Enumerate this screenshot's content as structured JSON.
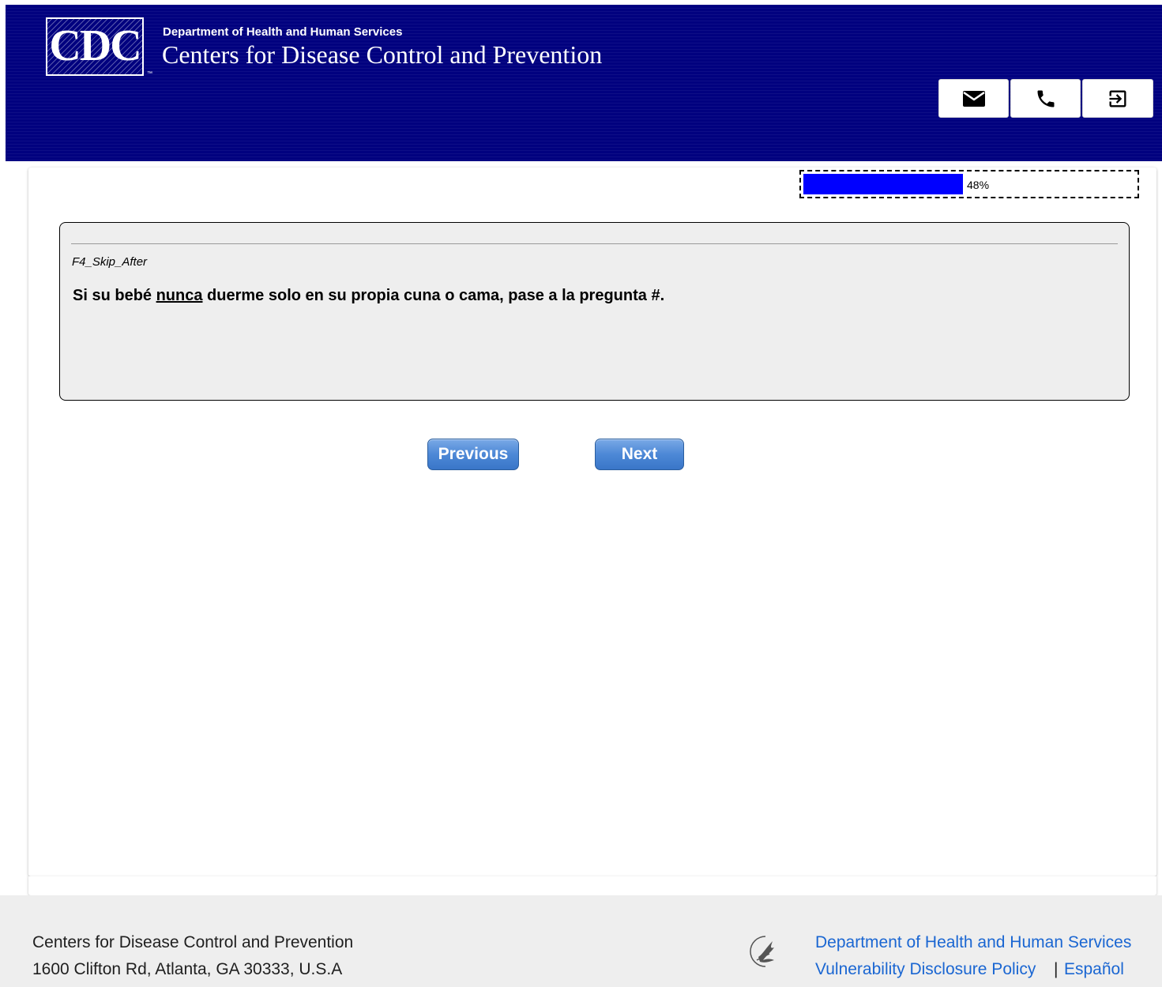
{
  "header": {
    "logo_text": "CDC",
    "department": "Department of Health and Human Services",
    "agency": "Centers for Disease Control and Prevention",
    "buttons": [
      {
        "icon": "mail-icon"
      },
      {
        "icon": "phone-icon"
      },
      {
        "icon": "exit-icon"
      }
    ],
    "background_color": "#01017f"
  },
  "progress": {
    "percent": 48,
    "label": "48%",
    "fill_color": "#0000ff"
  },
  "question": {
    "code": "F4_Skip_After",
    "text_before": "Si su bebé ",
    "text_underlined": "nunca",
    "text_after": " duerme solo en su propia cuna o cama, pase a la pregunta #."
  },
  "navigation": {
    "previous_label": "Previous",
    "next_label": "Next"
  },
  "footer": {
    "org_name": "Centers for Disease Control and Prevention",
    "address": "1600 Clifton Rd, Atlanta, GA 30333, U.S.A",
    "links": {
      "hhs": "Department of Health and Human Services",
      "vdp": "Vulnerability Disclosure Policy",
      "separator": "|",
      "espanol": "Español"
    },
    "link_color": "#1a66d2"
  }
}
